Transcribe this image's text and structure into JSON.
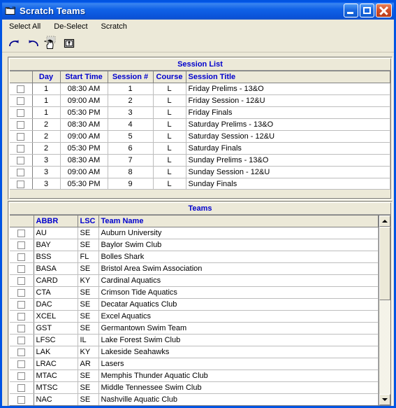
{
  "window": {
    "title": "Scratch Teams",
    "icon": "folder-icon",
    "buttons": {
      "minimize": "minimize-button",
      "maximize": "maximize-button",
      "close": "close-button"
    }
  },
  "menu": {
    "items": [
      {
        "label": "Select All"
      },
      {
        "label": "De-Select"
      },
      {
        "label": "Scratch"
      }
    ]
  },
  "toolbar": {
    "items": [
      {
        "name": "redo-icon",
        "title": "Redo"
      },
      {
        "name": "undo-icon",
        "title": "Undo"
      },
      {
        "name": "hand-select-icon",
        "title": "Select"
      },
      {
        "name": "export-box-icon",
        "title": "Export"
      }
    ]
  },
  "session_list": {
    "caption": "Session List",
    "columns": [
      "",
      "Day",
      "Start Time",
      "Session #",
      "Course",
      "Session Title"
    ],
    "rows": [
      {
        "checked": false,
        "day": "1",
        "start_time": "08:30 AM",
        "session_no": "1",
        "course": "L",
        "title": "Friday Prelims - 13&O"
      },
      {
        "checked": false,
        "day": "1",
        "start_time": "09:00 AM",
        "session_no": "2",
        "course": "L",
        "title": "Friday Session - 12&U"
      },
      {
        "checked": false,
        "day": "1",
        "start_time": "05:30 PM",
        "session_no": "3",
        "course": "L",
        "title": "Friday Finals"
      },
      {
        "checked": false,
        "day": "2",
        "start_time": "08:30 AM",
        "session_no": "4",
        "course": "L",
        "title": "Saturday Prelims - 13&O"
      },
      {
        "checked": false,
        "day": "2",
        "start_time": "09:00 AM",
        "session_no": "5",
        "course": "L",
        "title": "Saturday Session - 12&U"
      },
      {
        "checked": false,
        "day": "2",
        "start_time": "05:30 PM",
        "session_no": "6",
        "course": "L",
        "title": "Saturday Finals"
      },
      {
        "checked": false,
        "day": "3",
        "start_time": "08:30 AM",
        "session_no": "7",
        "course": "L",
        "title": "Sunday Prelims - 13&O"
      },
      {
        "checked": false,
        "day": "3",
        "start_time": "09:00 AM",
        "session_no": "8",
        "course": "L",
        "title": "Sunday Session - 12&U"
      },
      {
        "checked": false,
        "day": "3",
        "start_time": "05:30 PM",
        "session_no": "9",
        "course": "L",
        "title": "Sunday Finals"
      }
    ]
  },
  "teams": {
    "caption": "Teams",
    "columns": [
      "",
      "ABBR",
      "LSC",
      "Team Name"
    ],
    "rows": [
      {
        "checked": false,
        "abbr": "AU",
        "lsc": "SE",
        "team_name": "Auburn University"
      },
      {
        "checked": false,
        "abbr": "BAY",
        "lsc": "SE",
        "team_name": "Baylor Swim Club"
      },
      {
        "checked": false,
        "abbr": "BSS",
        "lsc": "FL",
        "team_name": "Bolles Shark"
      },
      {
        "checked": false,
        "abbr": "BASA",
        "lsc": "SE",
        "team_name": "Bristol Area Swim Association"
      },
      {
        "checked": false,
        "abbr": "CARD",
        "lsc": "KY",
        "team_name": "Cardinal Aquatics"
      },
      {
        "checked": false,
        "abbr": "CTA",
        "lsc": "SE",
        "team_name": "Crimson Tide Aquatics"
      },
      {
        "checked": false,
        "abbr": "DAC",
        "lsc": "SE",
        "team_name": "Decatar Aquatics Club"
      },
      {
        "checked": false,
        "abbr": "XCEL",
        "lsc": "SE",
        "team_name": "Excel Aquatics"
      },
      {
        "checked": false,
        "abbr": "GST",
        "lsc": "SE",
        "team_name": "Germantown Swim Team"
      },
      {
        "checked": false,
        "abbr": "LFSC",
        "lsc": "IL",
        "team_name": "Lake Forest Swim Club"
      },
      {
        "checked": false,
        "abbr": "LAK",
        "lsc": "KY",
        "team_name": "Lakeside Seahawks"
      },
      {
        "checked": false,
        "abbr": "LRAC",
        "lsc": "AR",
        "team_name": "Lasers"
      },
      {
        "checked": false,
        "abbr": "MTAC",
        "lsc": "SE",
        "team_name": "Memphis Thunder Aquatic Club"
      },
      {
        "checked": false,
        "abbr": "MTSC",
        "lsc": "SE",
        "team_name": "Middle Tennessee Swim Club"
      },
      {
        "checked": false,
        "abbr": "NAC",
        "lsc": "SE",
        "team_name": "Nashville Aquatic Club"
      }
    ],
    "scrollbar": {
      "up": "scroll-up-arrow",
      "down": "scroll-down-arrow"
    }
  },
  "colors": {
    "titlebar_blue": "#0054e3",
    "header_text_blue": "#0000cd",
    "panel_face": "#ece9d8",
    "grid_background": "#ffffff"
  }
}
